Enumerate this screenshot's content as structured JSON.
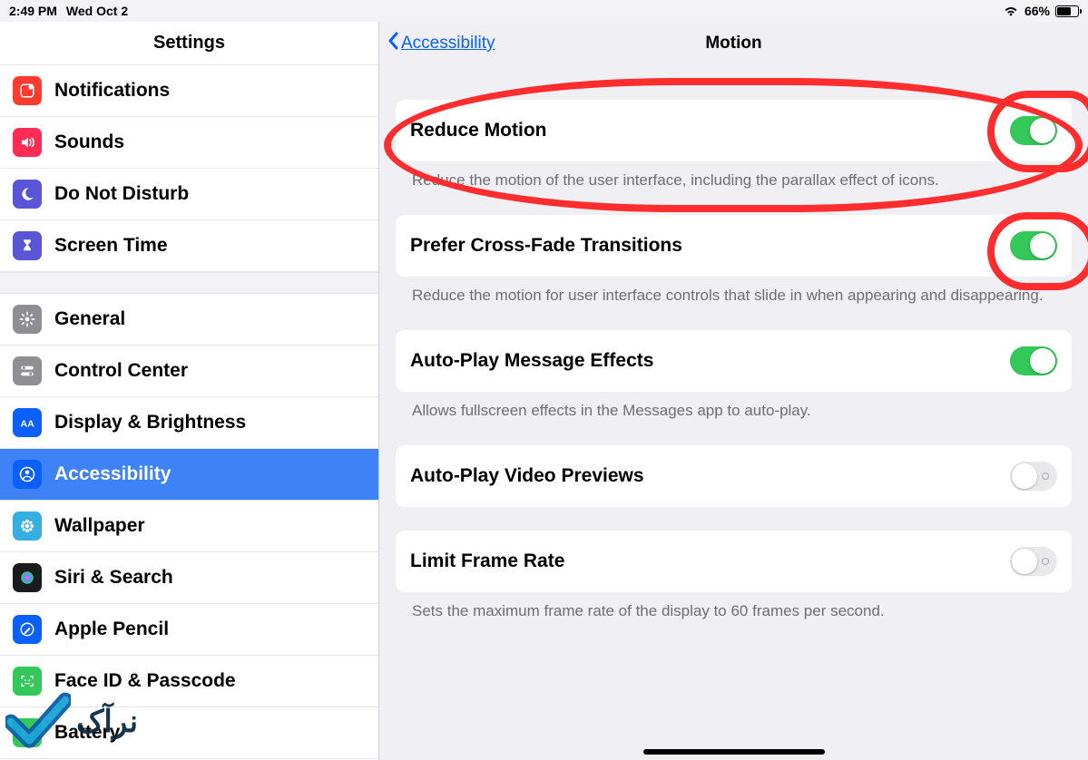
{
  "statusbar": {
    "time": "2:49 PM",
    "date": "Wed Oct 2",
    "battery_pct": "66%"
  },
  "sidebar": {
    "title": "Settings",
    "groups": [
      [
        {
          "id": "notifications",
          "label": "Notifications",
          "icon": "notifications",
          "bg": "#ff3b30"
        },
        {
          "id": "sounds",
          "label": "Sounds",
          "icon": "speaker",
          "bg": "#ff2d55"
        },
        {
          "id": "dnd",
          "label": "Do Not Disturb",
          "icon": "moon",
          "bg": "#5856d6"
        },
        {
          "id": "screentime",
          "label": "Screen Time",
          "icon": "hourglass",
          "bg": "#5856d6"
        }
      ],
      [
        {
          "id": "general",
          "label": "General",
          "icon": "gear",
          "bg": "#8e8e93"
        },
        {
          "id": "controlcenter",
          "label": "Control Center",
          "icon": "switches",
          "bg": "#8e8e93"
        },
        {
          "id": "display",
          "label": "Display & Brightness",
          "icon": "aa",
          "bg": "#0a60ff"
        },
        {
          "id": "accessibility",
          "label": "Accessibility",
          "icon": "person",
          "bg": "#0a60ff",
          "selected": true
        },
        {
          "id": "wallpaper",
          "label": "Wallpaper",
          "icon": "flower",
          "bg": "#37aee2"
        },
        {
          "id": "siri",
          "label": "Siri & Search",
          "icon": "siri",
          "bg": "#1b1b1d"
        },
        {
          "id": "pencil",
          "label": "Apple Pencil",
          "icon": "pencil",
          "bg": "#0a60ff"
        },
        {
          "id": "faceid",
          "label": "Face ID & Passcode",
          "icon": "faceid",
          "bg": "#34c759"
        },
        {
          "id": "battery",
          "label": "Battery",
          "icon": "battery",
          "bg": "#34c759"
        }
      ]
    ]
  },
  "detail": {
    "back_label": "Accessibility",
    "title": "Motion",
    "settings": [
      {
        "id": "reduce-motion",
        "label": "Reduce Motion",
        "on": true,
        "desc": "Reduce the motion of the user interface, including the parallax effect of icons."
      },
      {
        "id": "cross-fade",
        "label": "Prefer Cross-Fade Transitions",
        "on": true,
        "desc": "Reduce the motion for user interface controls that slide in when appearing and disappearing."
      },
      {
        "id": "msg-effects",
        "label": "Auto-Play Message Effects",
        "on": true,
        "desc": "Allows fullscreen effects in the Messages app to auto-play."
      },
      {
        "id": "video-previews",
        "label": "Auto-Play Video Previews",
        "on": false,
        "desc": ""
      },
      {
        "id": "limit-fps",
        "label": "Limit Frame Rate",
        "on": false,
        "desc": "Sets the maximum frame rate of the display to 60 frames per second."
      }
    ]
  },
  "watermark_text": "نرآک"
}
